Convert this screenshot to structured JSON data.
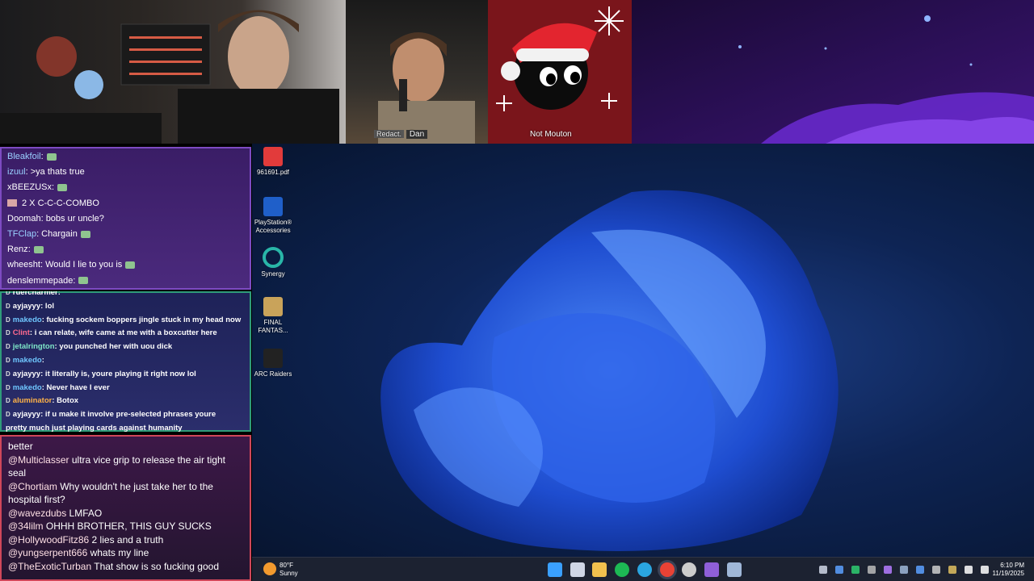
{
  "cams": {
    "mid_label_badge": "Redact.",
    "mid_label_name": "Dan",
    "right_label": "Not Mouton"
  },
  "chat1": [
    {
      "user": "Bleakfoil",
      "color": "#9ad0ff",
      "text": ":",
      "emote": true
    },
    {
      "user": "izuul",
      "color": "#9ad0ff",
      "text": ": >ya thats true"
    },
    {
      "user": "xBEEZUSx",
      "color": "#ffffff",
      "text": ":",
      "emote": true
    },
    {
      "user": "",
      "color": "#ffffff",
      "text": "2 X C-C-C-COMBO",
      "emote": true
    },
    {
      "user": "Doomah",
      "color": "#ffffff",
      "text": ": bobs ur uncle?"
    },
    {
      "user": "TFClap",
      "color": "#9ad0ff",
      "text": ": Chargain",
      "emote": true
    },
    {
      "user": "Renz",
      "color": "#ffffff",
      "text": ":",
      "emote": true
    },
    {
      "user": "wheesht",
      "color": "#ffffff",
      "text": ": Would I lie to you is",
      "emote": true
    },
    {
      "user": "denslemmepade",
      "color": "#ffffff",
      "text": ":",
      "emote": true
    }
  ],
  "chat2": [
    {
      "user": "rüercharmer",
      "color": "#ffffff",
      "text": ":"
    },
    {
      "user": "ayjayyy",
      "color": "#ffffff",
      "text": ": lol"
    },
    {
      "user": "makedo",
      "color": "#6fc7ff",
      "text": ": fucking sockem boppers jingle stuck in my head now"
    },
    {
      "user": "Clint",
      "color": "#ff6a8f",
      "text": ": i can relate, wife came at me with a boxcutter here"
    },
    {
      "user": "jetalrington",
      "color": "#7ee6c8",
      "text": ": you punched her with uou dick"
    },
    {
      "user": "makedo",
      "color": "#6fc7ff",
      "text": ":"
    },
    {
      "user": "ayjayyy",
      "color": "#ffffff",
      "text": ": it literally is, youre playing it right now lol"
    },
    {
      "user": "makedo",
      "color": "#6fc7ff",
      "text": ": Never have I ever"
    },
    {
      "user": "aluminator",
      "color": "#ffb347",
      "text": ": Botox"
    },
    {
      "user": "ayjayyy",
      "color": "#ffffff",
      "text": ": if u make it involve pre-selected phrases youre"
    },
    {
      "user": "",
      "color": "#ffffff",
      "text": "pretty much just playing cards against humanity"
    }
  ],
  "chat3": [
    {
      "mention": "",
      "text": "better"
    },
    {
      "mention": "@Multiclasser",
      "text": " ultra vice grip to release the air tight seal"
    },
    {
      "mention": "@Chortiam",
      "text": " Why wouldn't he just take her to the hospital first?"
    },
    {
      "mention": "@wavezdubs",
      "text": " LMFAO"
    },
    {
      "mention": "@34lilm",
      "text": " OHHH BROTHER, THIS GUY SUCKS"
    },
    {
      "mention": "@HollywoodFitz86",
      "text": " 2 lies and a truth"
    },
    {
      "mention": "@yungserpent666",
      "text": " whats my line"
    },
    {
      "mention": "@TheExoticTurban",
      "text": " That show is so fucking good"
    }
  ],
  "desktop_icons": [
    {
      "name": "pdf-file-icon",
      "label": "961691.pdf",
      "color": "#e23b3b"
    },
    {
      "name": "playstation-accessories-icon",
      "label": "PlayStation® Accessories",
      "color": "#1f5fc9"
    },
    {
      "name": "synergy-icon",
      "label": "Synergy",
      "color": "#29b6a8"
    },
    {
      "name": "final-fantasy-icon",
      "label": "FINAL FANTAS...",
      "color": "#c9a35a"
    },
    {
      "name": "arc-raiders-icon",
      "label": "ARC Raiders",
      "color": "#222222"
    }
  ],
  "taskbar": {
    "weather_temp": "80°F",
    "weather_desc": "Sunny",
    "time": "6:10 PM",
    "date": "11/19/2025",
    "apps": [
      {
        "name": "windows-start-icon",
        "color": "#3aa0ff"
      },
      {
        "name": "task-view-icon",
        "color": "#cfd6e6"
      },
      {
        "name": "file-explorer-icon",
        "color": "#f2c14e"
      },
      {
        "name": "spotify-icon",
        "color": "#1db954"
      },
      {
        "name": "edge-icon",
        "color": "#2aa5e0"
      },
      {
        "name": "chrome-icon",
        "color": "#e94235"
      },
      {
        "name": "obs-icon",
        "color": "#cccccc"
      },
      {
        "name": "app-purple-icon",
        "color": "#8f5fd8"
      },
      {
        "name": "steam-icon",
        "color": "#9fb7d8"
      }
    ],
    "tray": [
      {
        "name": "chevron-up-icon",
        "color": "#cfd6e6"
      },
      {
        "name": "bluetooth-icon",
        "color": "#5aa0ff"
      },
      {
        "name": "tray-app-icon-1",
        "color": "#2ecc71"
      },
      {
        "name": "tray-app-icon-2",
        "color": "#bbbbbb"
      },
      {
        "name": "tray-app-icon-3",
        "color": "#b57bff"
      },
      {
        "name": "steam-tray-icon",
        "color": "#9fb7d8"
      },
      {
        "name": "tray-app-icon-4",
        "color": "#5aa0ff"
      },
      {
        "name": "tray-app-icon-5",
        "color": "#cccccc"
      },
      {
        "name": "tray-app-icon-6",
        "color": "#e0c060"
      },
      {
        "name": "network-icon",
        "color": "#ffffff"
      },
      {
        "name": "volume-icon",
        "color": "#ffffff"
      }
    ]
  }
}
